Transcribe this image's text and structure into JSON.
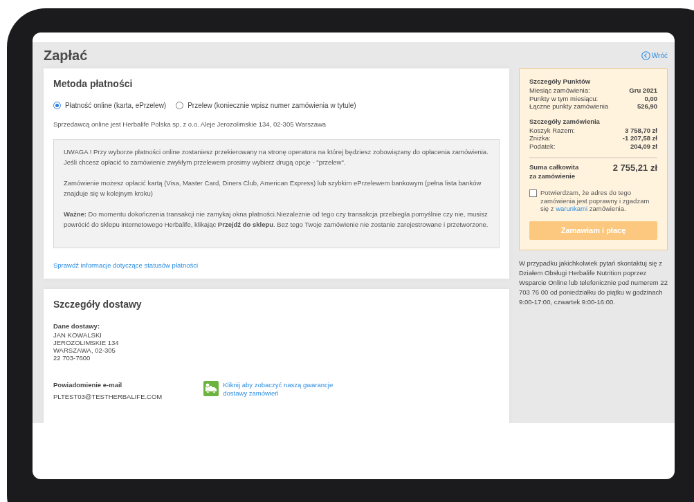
{
  "page": {
    "title": "Zapłać",
    "back_link": "Wróć"
  },
  "payment": {
    "title": "Metoda płatności",
    "options": [
      {
        "label": "Płatność online (karta, ePrzelew)",
        "selected": true
      },
      {
        "label": "Przelew (koniecznie wpisz numer zamówienia w tytule)",
        "selected": false
      }
    ],
    "seller": "Sprzedawcą online jest Herbalife Polska sp. z o.o. Aleje Jerozolimskie 134, 02-305 Warszawa",
    "notice": [
      "UWAGA ! Przy wyborze płatności online zostaniesz przekierowany na stronę operatora na której będziesz zobowiązany do opłacenia zamówienia. Jeśli chcesz opłacić to zamówienie zwykłym przelewem prosimy wybierz drugą opcje - \"przelew\".",
      "Zamówienie możesz opłacić kartą (Visa, Master Card, Diners Club, American Express) lub szybkim ePrzelewem bankowym (pełna lista banków znajduje się w kolejnym kroku)",
      "**Ważne:** Do momentu dokończenia transakcji nie zamykaj okna płatności.Niezależnie od tego czy transakcja przebiegła pomyślnie czy nie, musisz powrócić do sklepu internetowego Herbalife, klikając **Przejdź do sklepu**. Bez tego Twoje zamówienie nie zostanie zarejestrowane i przetworzone."
    ],
    "status_link": "Sprawdź informacje dotyczące statusów płatności"
  },
  "delivery": {
    "title": "Szczegóły dostawy",
    "address_label": "Dane dostawy:",
    "address_lines": [
      "JAN KOWALSKI",
      "JEROZOLIMSKIE 134",
      "WARSZAWA, 02-305",
      "22 703-7600"
    ],
    "email_label": "Powiadomienie e-mail",
    "email": "PLTEST03@TESTHERBALIFE.COM",
    "guarantee_link": "Kliknij aby zobaczyć naszą gwarancje dostawy zamówień"
  },
  "summary": {
    "sections": [
      {
        "title": "Szczegóły Punktów",
        "rows": [
          {
            "label": "Miesiąc zamówienia:",
            "value": "Gru 2021"
          },
          {
            "label": "Punkty w tym miesiącu:",
            "value": "0,00"
          },
          {
            "label": "Łączne punkty zamówienia",
            "value": "526,90"
          }
        ]
      },
      {
        "title": "Szczegóły zamówienia",
        "rows": [
          {
            "label": "Koszyk Razem:",
            "value": "3 758,70 zł"
          },
          {
            "label": "Zniżka:",
            "value": "-1 207,58 zł"
          },
          {
            "label": "Podatek:",
            "value": "204,09 zł"
          }
        ]
      }
    ],
    "total_label": "Suma całkowita za zamówienie",
    "total_value": "2 755,21 zł",
    "confirm": {
      "checked": false,
      "before": "Potwierdzam, że adres do tego zamówienia jest poprawny i zgadzam się z",
      "link": "warunkami",
      "after": "zamówienia."
    },
    "order_button": {
      "label": "Zamawiam i płacę",
      "disabled": true
    }
  },
  "contact_info": "W przypadku jakichkolwiek pytań skontaktuj się z Działem Obsługi Herbalife Nutrition poprzez Wsparcie Online lub telefonicznie pod numerem 22 703 76 00 od poniedziałku do piątku w godzinach 9:00-17:00, czwartek 9:00-16:00."
}
